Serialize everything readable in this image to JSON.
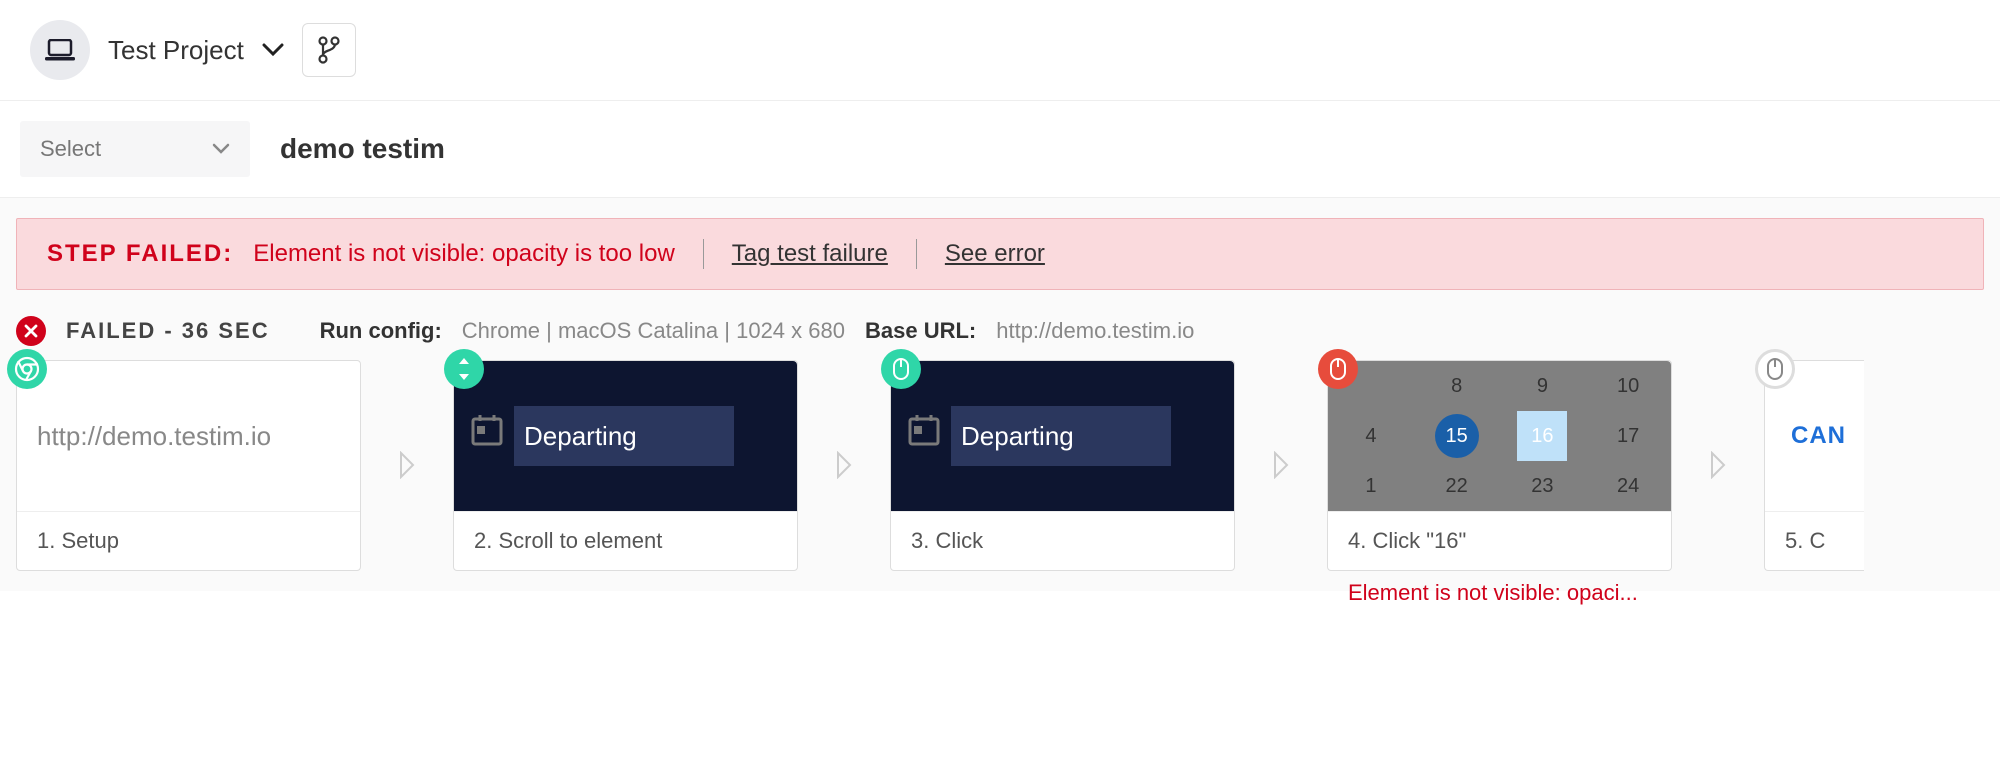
{
  "header": {
    "project_name": "Test Project"
  },
  "subheader": {
    "select_label": "Select",
    "test_name": "demo testim"
  },
  "error_banner": {
    "label": "STEP FAILED:",
    "message": "Element is not visible: opacity is too low",
    "tag_link": "Tag test failure",
    "see_error": "See error"
  },
  "status": {
    "fail_text": "FAILED - 36 SEC",
    "run_config_label": "Run config:",
    "run_config_value": "Chrome | macOS Catalina | 1024 x 680",
    "base_url_label": "Base URL:",
    "base_url_value": "http://demo.testim.io"
  },
  "steps": [
    {
      "badge": "chrome",
      "thumb_url": "http://demo.testim.io",
      "caption": "1. Setup"
    },
    {
      "badge": "scroll",
      "thumb_label": "Departing",
      "caption": "2. Scroll to element"
    },
    {
      "badge": "mouse-green",
      "thumb_label": "Departing",
      "caption": "3. Click"
    },
    {
      "badge": "mouse-red",
      "calendar": {
        "row1": [
          "8",
          "9",
          "10"
        ],
        "row2": [
          "4",
          "15",
          "16",
          "17"
        ],
        "row3": [
          "1",
          "22",
          "23",
          "24"
        ],
        "selected": "15",
        "highlight": "16"
      },
      "caption": "4. Click \"16\"",
      "error_text": "Element is not visible: opaci..."
    },
    {
      "badge": "mouse-white",
      "thumb_cancel": "CAN",
      "caption": "5. C"
    }
  ]
}
